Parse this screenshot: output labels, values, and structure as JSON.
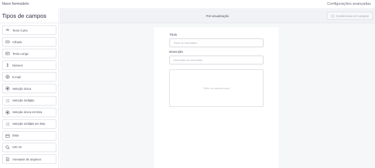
{
  "topbar": {
    "form_name": "Novo formulário",
    "advanced_settings": "Configurações avançadas"
  },
  "sidebar": {
    "title": "Tipos de campos",
    "items": [
      {
        "label": "Texto Curto",
        "icon": "short-text-icon"
      },
      {
        "label": "Cifrado",
        "icon": "encrypted-icon"
      },
      {
        "label": "Texto Longo",
        "icon": "long-text-icon"
      },
      {
        "label": "Número",
        "icon": "number-icon"
      },
      {
        "label": "E-mail",
        "icon": "email-icon"
      },
      {
        "label": "Seleção única",
        "icon": "radio-icon"
      },
      {
        "label": "Seleção múltipla",
        "icon": "multi-select-icon"
      },
      {
        "label": "Seleção única em lista",
        "icon": "radio-list-icon"
      },
      {
        "label": "Seleção múltipla em lista",
        "icon": "multi-select-list-icon"
      },
      {
        "label": "Data",
        "icon": "calendar-icon"
      },
      {
        "label": "CID 10",
        "icon": "search-icon"
      },
      {
        "label": "Anexador de arquivos",
        "icon": "file-icon"
      }
    ]
  },
  "main": {
    "preview_title": "Pré-visualização",
    "conditions_button": "Condicionais em campos",
    "form": {
      "title_label": "Título",
      "title_placeholder": "Título do formulário",
      "description_label": "Descrição",
      "description_placeholder": "Descrição do formulário",
      "dropzone_text": "Solte os campos aqui"
    }
  },
  "colors": {
    "sidebar_border": "#e3e4ea",
    "preview_background": "#f6f7f9",
    "card_background": "#ffffff",
    "placeholder_text": "#a6a9b5"
  }
}
